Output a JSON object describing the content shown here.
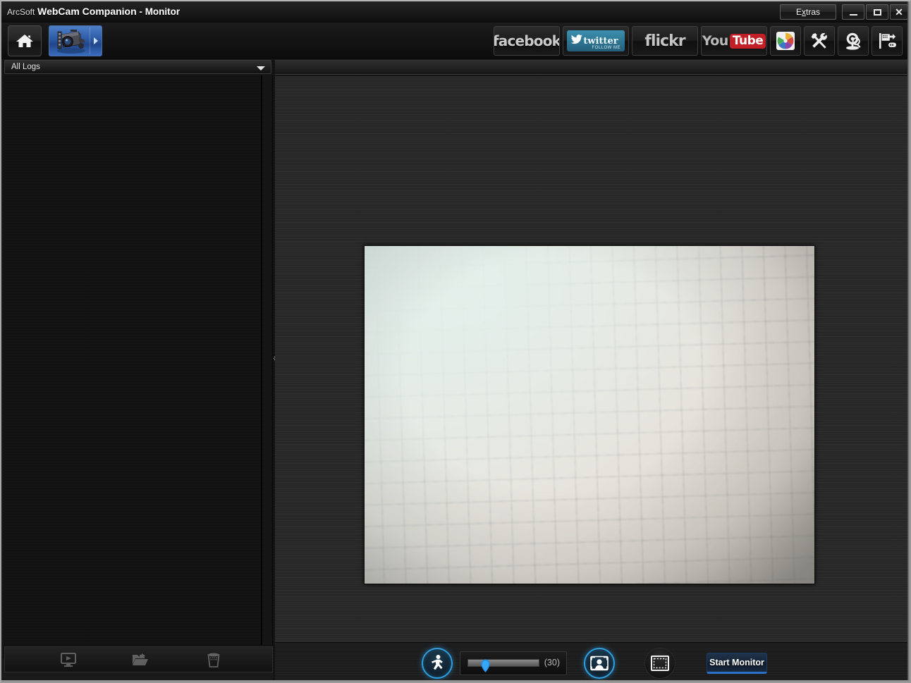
{
  "window": {
    "brand": "ArcSoft",
    "app_name": "WebCam Companion",
    "module_separator": "-",
    "module_name": "Monitor",
    "controls": {
      "extras_label": "Extras",
      "extras_accel": "x",
      "minimize_label": "Minimize",
      "maximize_label": "Maximize",
      "close_label": "Close",
      "close_glyph": "✕"
    }
  },
  "toolbar": {
    "home_label": "Home",
    "home_icon": "home-icon",
    "active_tab": {
      "label": "Capture",
      "icon": "camera-icon",
      "expand_icon": "chevron-right-icon"
    },
    "social_buttons": [
      {
        "id": "facebook",
        "label": "facebook",
        "icon": "facebook-icon"
      },
      {
        "id": "twitter",
        "label": "twitter",
        "sublabel": "FOLLOW ME",
        "icon": "twitter-bird-icon"
      },
      {
        "id": "flickr",
        "label": "flickr",
        "icon": "flickr-icon"
      },
      {
        "id": "youtube",
        "label_you": "You",
        "label_tube": "Tube",
        "icon": "youtube-icon"
      },
      {
        "id": "picasa",
        "label": "Picasa",
        "icon": "picasa-pinwheel-icon"
      },
      {
        "id": "tools",
        "label": "Tools",
        "icon": "wrench-screwdriver-icon"
      },
      {
        "id": "camera-settings",
        "label": "Camera Settings",
        "icon": "webcam-magnifier-icon"
      },
      {
        "id": "export-device",
        "label": "Export to Device",
        "icon": "device-export-icon"
      }
    ]
  },
  "sidebar": {
    "log_filter": {
      "selected": "All Logs",
      "options": [
        "All Logs"
      ],
      "arrow_icon": "chevron-down-icon"
    },
    "log_items": [],
    "footer_buttons": [
      {
        "id": "play",
        "label": "Play",
        "icon": "play-monitor-icon",
        "enabled": false
      },
      {
        "id": "open",
        "label": "Open Folder",
        "icon": "open-folder-icon",
        "enabled": false
      },
      {
        "id": "delete",
        "label": "Delete",
        "icon": "trash-icon",
        "enabled": false
      }
    ]
  },
  "main": {
    "preview": {
      "label": "Live camera preview",
      "content_description": "Graph paper grid"
    },
    "controls": {
      "motion_detection": {
        "label": "Motion Detection",
        "icon": "running-person-icon",
        "active": true
      },
      "sensitivity": {
        "label": "Sensitivity",
        "value": 30,
        "display": "(30)",
        "min": 0,
        "max": 100
      },
      "face_detection": {
        "label": "Face Detection",
        "icon": "face-detect-icon",
        "active": true
      },
      "region_select": {
        "label": "Detection Region",
        "icon": "region-marquee-icon",
        "active": false
      },
      "start_button": {
        "label": "Start Monitor"
      }
    }
  },
  "colors": {
    "accent_blue": "#2f9fe0",
    "tab_blue": "#2f5ea8",
    "button_blue": "#2a72c7",
    "twitter_blue": "#2e7694",
    "youtube_red": "#c31f26",
    "window_bg": "#292929",
    "panel_dark": "#131313"
  }
}
